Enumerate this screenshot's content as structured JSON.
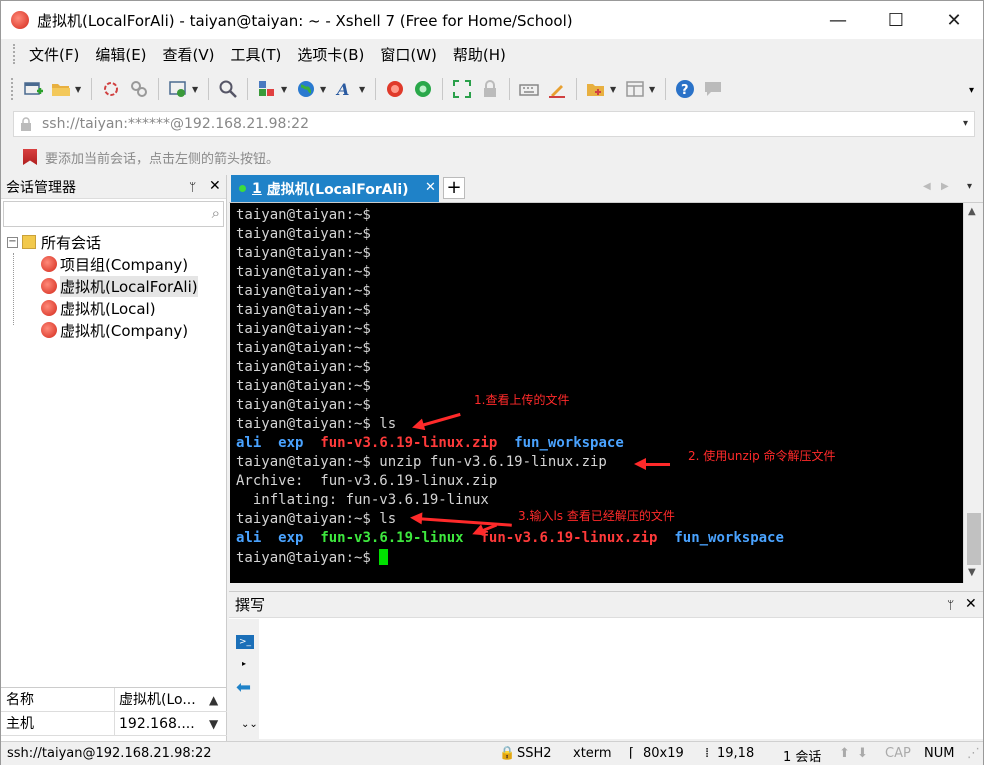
{
  "window": {
    "title": "虚拟机(LocalForAli) - taiyan@taiyan: ~ - Xshell 7 (Free for Home/School)",
    "controls": {
      "minimize": "—",
      "maximize": "☐",
      "close": "✕"
    }
  },
  "menubar": {
    "items": [
      "文件(F)",
      "编辑(E)",
      "查看(V)",
      "工具(T)",
      "选项卡(B)",
      "窗口(W)",
      "帮助(H)"
    ]
  },
  "toolbar": {
    "icons": [
      "new-session-icon",
      "open-folder-icon",
      "reconnect-icon",
      "disconnect-icon",
      "properties-icon",
      "find-icon",
      "transfer-icon",
      "globe-icon",
      "font-icon",
      "xshell-icon",
      "xftp-icon",
      "fullscreen-icon",
      "lock-icon",
      "keyboard-icon",
      "highlight-icon",
      "new-tab-icon",
      "layout-icon",
      "help-icon",
      "chat-icon"
    ],
    "overflow": "▾"
  },
  "addressbar": {
    "value": "ssh://taiyan:******@192.168.21.98:22",
    "dropdown": "▾"
  },
  "hint": {
    "text": "要添加当前会话，点击左侧的箭头按钮。"
  },
  "session_manager": {
    "title": "会话管理器",
    "pin": "ᛘ",
    "close": "✕",
    "search_placeholder": "",
    "root": {
      "expander": "−",
      "label": "所有会话"
    },
    "sessions": [
      {
        "label": "项目组(Company)",
        "selected": false
      },
      {
        "label": "虚拟机(LocalForAli)",
        "selected": true
      },
      {
        "label": "虚拟机(Local)",
        "selected": false
      },
      {
        "label": "虚拟机(Company)",
        "selected": false
      }
    ],
    "properties": [
      {
        "key": "名称",
        "value": "虚拟机(Lo..."
      },
      {
        "key": "主机",
        "value": "192.168...."
      }
    ]
  },
  "tabs": {
    "active": {
      "number": "1",
      "label": "虚拟机(LocalForAli)",
      "close": "✕"
    },
    "add": "+",
    "nav_left": "◀",
    "nav_right": "▶",
    "nav_menu": "▾"
  },
  "terminal": {
    "prompt": "taiyan@taiyan:~$",
    "empty_prompts": 11,
    "cmd_ls": " ls",
    "ls1": {
      "dir_ali": "ali",
      "dir_exp": "exp",
      "zip": "fun-v3.6.19-linux.zip",
      "dir_ws": "fun_workspace"
    },
    "cmd_unzip": " unzip fun-v3.6.19-linux.zip",
    "archive_line": "Archive:  fun-v3.6.19-linux.zip",
    "inflating_line": "  inflating: fun-v3.6.19-linux",
    "ls2": {
      "dir_ali": "ali",
      "dir_exp": "exp",
      "exe": "fun-v3.6.19-linux",
      "zip": "fun-v3.6.19-linux.zip",
      "dir_ws": "fun_workspace"
    },
    "annotations": [
      "1.查看上传的文件",
      "2. 使用unzip 命令解压文件",
      "3.输入ls 查看已经解压的文件"
    ],
    "colors": {
      "blue": "#4aa3ff",
      "red": "#ff3a3a",
      "green": "#3ee83e",
      "annotation": "#ff2a2a"
    }
  },
  "scrollbar": {
    "up": "▲",
    "down": "▼"
  },
  "compose": {
    "title": "撰写",
    "pin": "ᛘ",
    "close": "✕",
    "cmd_icon": ">_",
    "more": "▸",
    "back_icon": "⬅",
    "dropdown": "⌄⌄"
  },
  "statusbar": {
    "address": "ssh://taiyan@192.168.21.98:22",
    "protocol": "SSH2",
    "terminal_type": "xterm",
    "size": "80x19",
    "cursor": "19,18",
    "sessions": "1 会话",
    "caps": "CAP",
    "num": "NUM"
  }
}
